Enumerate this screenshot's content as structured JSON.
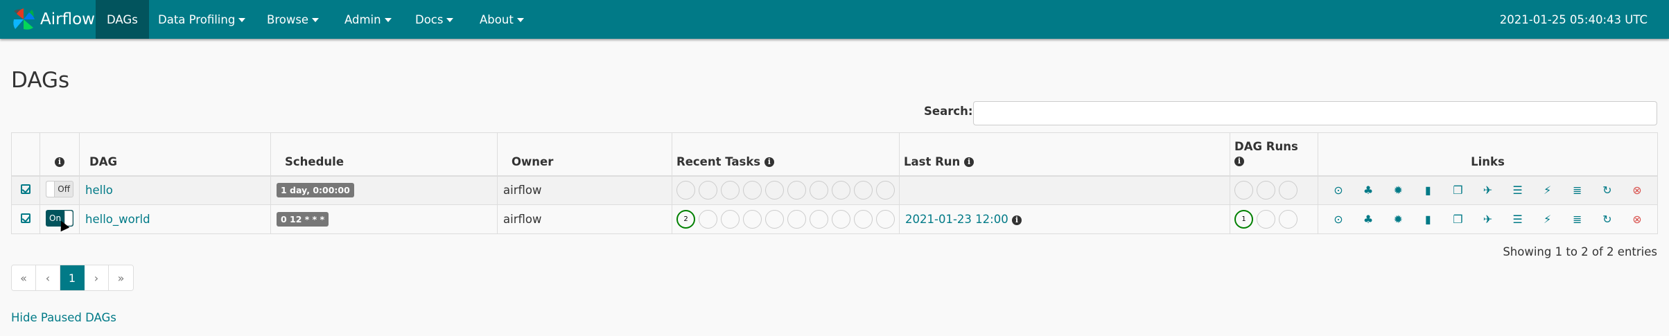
{
  "nav": {
    "brand": "Airflow",
    "items": [
      {
        "label": "DAGs",
        "active": true
      },
      {
        "label": "Data Profiling",
        "dropdown": true
      },
      {
        "label": "Browse",
        "dropdown": true
      },
      {
        "label": "Admin",
        "dropdown": true
      },
      {
        "label": "Docs",
        "dropdown": true
      },
      {
        "label": "About",
        "dropdown": true
      }
    ],
    "clock": "2021-01-25 05:40:43 UTC"
  },
  "page_title": "DAGs",
  "search": {
    "label": "Search:",
    "value": ""
  },
  "table": {
    "headers": {
      "dag": "DAG",
      "schedule": "Schedule",
      "owner": "Owner",
      "recent_tasks": "Recent Tasks",
      "last_run": "Last Run",
      "dag_runs": "DAG Runs",
      "links": "Links"
    },
    "rows": [
      {
        "toggle": "Off",
        "dag_id": "hello",
        "schedule": "1 day, 0:00:00",
        "owner": "airflow",
        "recent_tasks": [
          "",
          "",
          "",
          "",
          "",
          "",
          "",
          "",
          "",
          ""
        ],
        "last_run": "",
        "dag_runs": [
          "",
          "",
          ""
        ]
      },
      {
        "toggle": "On",
        "dag_id": "hello_world",
        "schedule": "0 12 * * *",
        "owner": "airflow",
        "recent_tasks": [
          "2",
          "",
          "",
          "",
          "",
          "",
          "",
          "",
          "",
          ""
        ],
        "last_run": "2021-01-23 12:00",
        "dag_runs": [
          "1",
          "",
          ""
        ]
      }
    ],
    "link_icons": [
      "trigger-dag-icon",
      "tree-view-icon",
      "graph-view-icon",
      "task-duration-icon",
      "task-tries-icon",
      "landing-times-icon",
      "gantt-icon",
      "code-icon",
      "logs-icon",
      "refresh-icon",
      "delete-icon"
    ]
  },
  "showing": "Showing 1 to 2 of 2 entries",
  "pagination": {
    "first": "«",
    "prev": "‹",
    "current": "1",
    "next": "›",
    "last": "»"
  },
  "hide_paused": "Hide Paused DAGs",
  "colors": {
    "brand": "#017a87",
    "nav_active": "#02545d",
    "success": "#008000",
    "delete": "#d9534f"
  }
}
